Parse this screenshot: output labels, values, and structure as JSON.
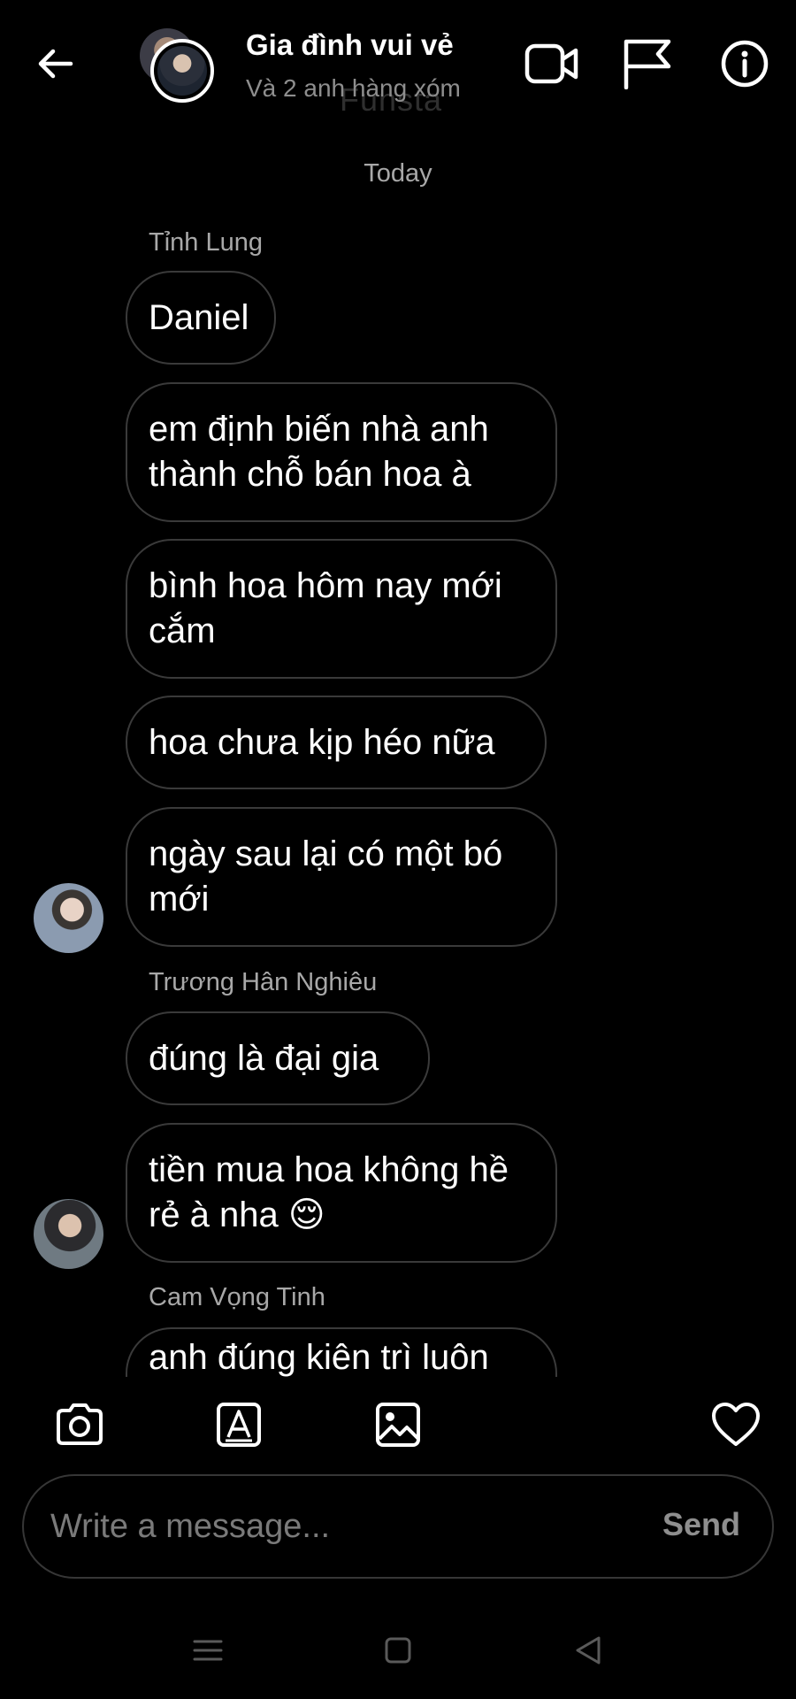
{
  "header": {
    "title": "Gia đình vui vẻ",
    "subtitle": "Và 2 anh hàng xóm",
    "watermark": "Funsta",
    "icons": [
      "back-arrow-icon",
      "video-call-icon",
      "flag-icon",
      "info-icon"
    ]
  },
  "date_separator": "Today",
  "groups": [
    {
      "sender": "Tỉnh Lung",
      "messages": [
        "Daniel",
        "em định biến nhà anh thành chỗ bán hoa à",
        "bình hoa hôm nay mới cắm",
        "hoa chưa kịp héo nữa",
        "ngày sau lại có một bó mới"
      ]
    },
    {
      "sender": "Trương Hân Nghiêu",
      "messages": [
        "đúng là đại gia",
        "tiền mua hoa không hề rẻ à nha 😌"
      ]
    },
    {
      "sender": "Cam Vọng Tinh",
      "messages": [
        "anh đúng kiên trì luôn"
      ]
    }
  ],
  "composer": {
    "placeholder": "Write a message...",
    "send_label": "Send",
    "tools": [
      "camera-icon",
      "sticker-icon",
      "gallery-icon",
      "heart-icon"
    ]
  },
  "nav_bar": [
    "menu-icon",
    "home-icon",
    "back-icon"
  ]
}
